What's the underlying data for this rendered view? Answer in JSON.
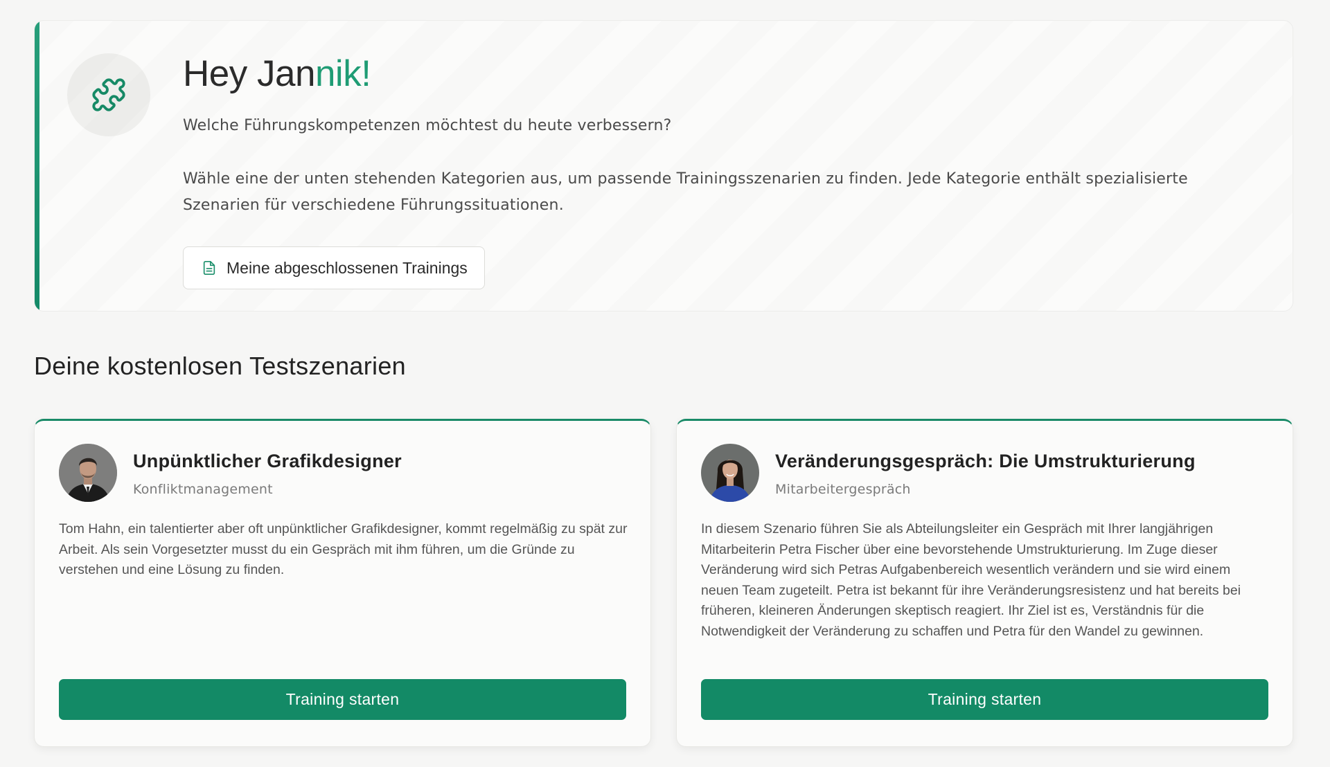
{
  "welcome": {
    "greeting_prefix": "Hey Jan",
    "greeting_accent": "nik!",
    "subtitle": "Welche Führungskompetenzen möchtest du heute verbessern?",
    "description": "Wähle eine der unten stehenden Kategorien aus, um passende Trainingsszenarien zu finden. Jede Kategorie enthält spezialisierte Szenarien für verschiedene Führungssituationen.",
    "completed_button_label": "Meine abgeschlossenen Trainings",
    "icon": "puzzle-icon",
    "button_icon": "document-icon"
  },
  "section": {
    "title": "Deine kostenlosen Testszenarien"
  },
  "scenarios": [
    {
      "title": "Unpünktlicher Grafikdesigner",
      "category": "Konfliktmanagement",
      "description": "Tom Hahn, ein talentierter aber oft unpünktlicher Grafikdesigner, kommt regelmäßig zu spät zur Arbeit. Als sein Vorgesetzter musst du ein Gespräch mit ihm führen, um die Gründe zu verstehen und eine Lösung zu finden.",
      "button_label": "Training starten",
      "avatar": "male-avatar"
    },
    {
      "title": "Veränderungsgespräch: Die Umstrukturierung",
      "category": "Mitarbeitergespräch",
      "description": "In diesem Szenario führen Sie als Abteilungsleiter ein Gespräch mit Ihrer langjährigen Mitarbeiterin Petra Fischer über eine bevorstehende Umstrukturierung. Im Zuge dieser Veränderung wird sich Petras Aufgabenbereich wesentlich verändern und sie wird einem neuen Team zugeteilt. Petra ist bekannt für ihre Veränderungsresistenz und hat bereits bei früheren, kleineren Änderungen skeptisch reagiert. Ihr Ziel ist es, Verständnis für die Notwendigkeit der Veränderung zu schaffen und Petra für den Wandel zu gewinnen.",
      "button_label": "Training starten",
      "avatar": "female-avatar"
    }
  ],
  "colors": {
    "accent": "#1f9c74",
    "button": "#138a66",
    "background": "#f6f6f5"
  }
}
